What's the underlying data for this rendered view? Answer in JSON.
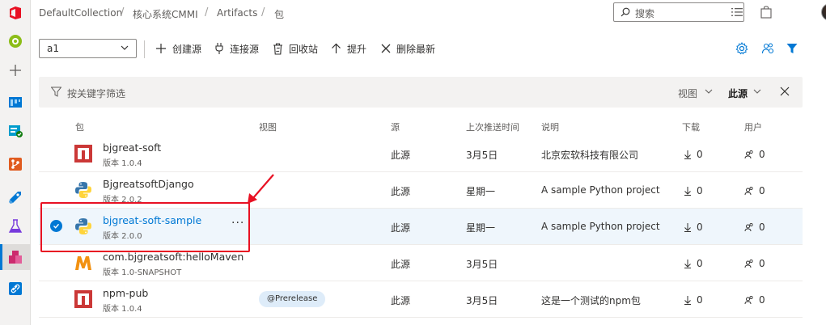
{
  "breadcrumb": {
    "items": [
      "DefaultCollection",
      "核心系统CMMI",
      "Artifacts",
      "包"
    ]
  },
  "search": {
    "placeholder": "搜索"
  },
  "feed_selector": {
    "value": "a1"
  },
  "toolbar": {
    "create_feed": "创建源",
    "connect_feed": "连接源",
    "recycle_bin": "回收站",
    "promote": "提升",
    "delete_latest": "删除最新"
  },
  "filter": {
    "placeholder": "按关键字筛选",
    "view_label": "视图",
    "source_label": "此源"
  },
  "table": {
    "columns": {
      "package": "包",
      "views": "视图",
      "source": "源",
      "last_pushed": "上次推送时间",
      "description": "说明",
      "downloads": "下载",
      "users": "用户"
    },
    "rows": [
      {
        "name": "bjgreat-soft",
        "version": "版本 1.0.4",
        "view_tag": "",
        "source": "此源",
        "last_pushed": "3月5日",
        "description": "北京宏软科技有限公司",
        "downloads": "0",
        "users": "0",
        "type": "npm",
        "selected": false
      },
      {
        "name": "BjgreatsoftDjango",
        "version": "版本 2.0.2",
        "view_tag": "",
        "source": "此源",
        "last_pushed": "星期一",
        "description": "A sample Python project",
        "downloads": "0",
        "users": "0",
        "type": "python",
        "selected": false
      },
      {
        "name": "bjgreat-soft-sample",
        "version": "版本 2.0.0",
        "view_tag": "",
        "source": "此源",
        "last_pushed": "星期一",
        "description": "A sample Python project",
        "downloads": "0",
        "users": "0",
        "type": "python",
        "selected": true,
        "more_label": "···"
      },
      {
        "name": "com.bjgreatsoft:helloMaven",
        "version": "版本 1.0-SNAPSHOT",
        "view_tag": "",
        "source": "此源",
        "last_pushed": "3月5日",
        "description": "",
        "downloads": "0",
        "users": "0",
        "type": "maven",
        "selected": false
      },
      {
        "name": "npm-pub",
        "version": "版本 1.0.4",
        "view_tag": "@Prerelease",
        "source": "此源",
        "last_pushed": "3月5日",
        "description": "这是一个测试的npm包",
        "downloads": "0",
        "users": "0",
        "type": "npm",
        "selected": false
      }
    ]
  },
  "colors": {
    "accent": "#0078d4",
    "annotation": "#e81123",
    "npm": "#cb3837",
    "maven": "#f29111"
  },
  "icons": {
    "leftnav": [
      "overview-icon",
      "add-icon",
      "boards-icon",
      "test-plans-icon",
      "repos-icon",
      "pipelines-icon",
      "test-icon",
      "artifacts-icon",
      "link-icon"
    ]
  }
}
